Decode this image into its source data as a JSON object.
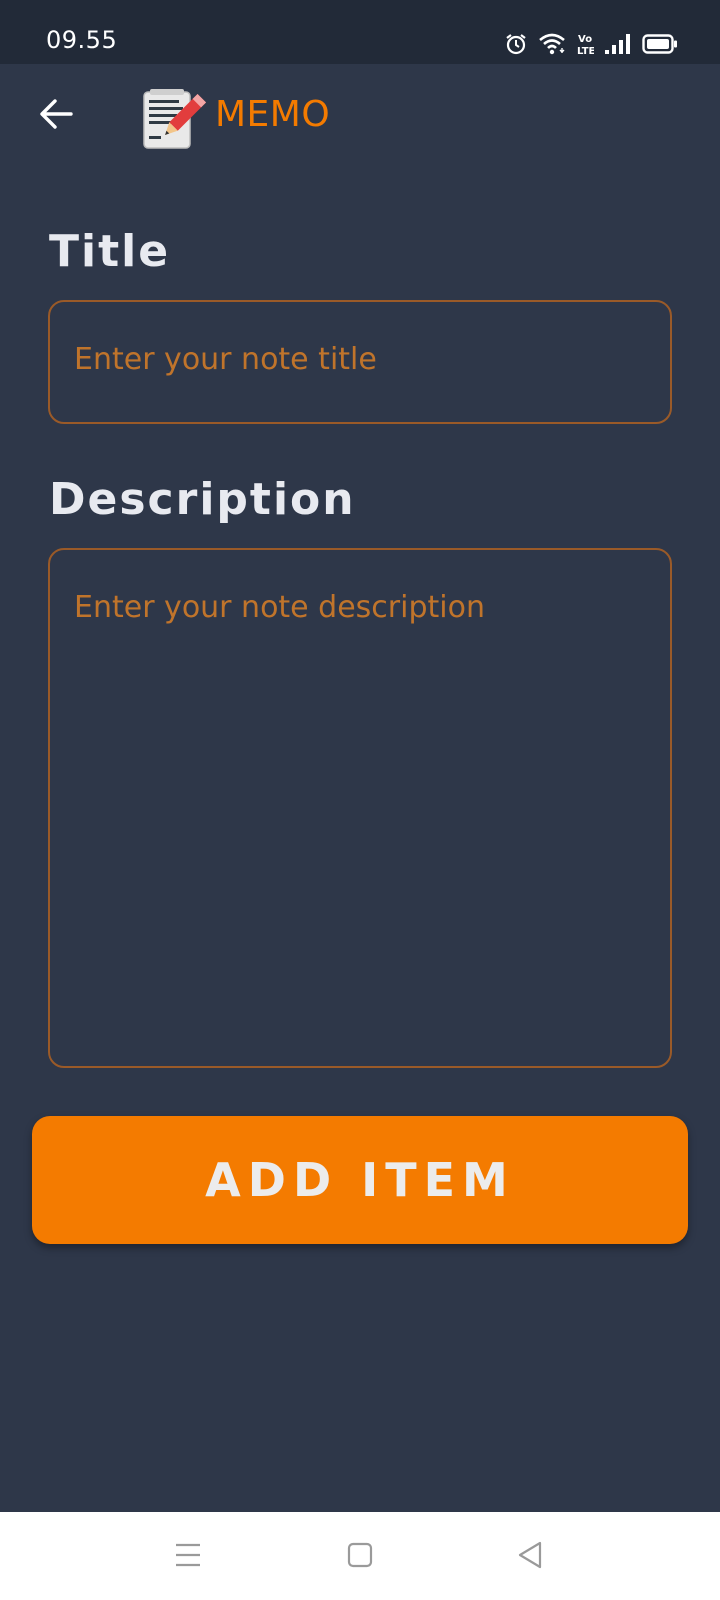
{
  "status_bar": {
    "time": "09.55",
    "icons": [
      "alarm-icon",
      "wifi-icon",
      "volte-icon",
      "signal-icon",
      "battery-icon"
    ],
    "volte_text": "Vo LTE"
  },
  "app_bar": {
    "title": "MEMO",
    "back_icon": "arrow-left-icon",
    "logo_icon": "memo-notepad-pencil-icon"
  },
  "form": {
    "title_label": "Title",
    "title_placeholder": "Enter your note title",
    "title_value": "",
    "description_label": "Description",
    "description_placeholder": "Enter your note description",
    "description_value": ""
  },
  "actions": {
    "add_item_label": "ADD ITEM"
  },
  "nav_bar": {
    "icons": [
      "menu-icon",
      "home-square-icon",
      "back-triangle-icon"
    ]
  },
  "colors": {
    "background": "#2e3749",
    "status_bar": "#222a38",
    "accent": "#f47b00",
    "input_border": "#9a5a28",
    "placeholder": "#c0742b",
    "label_text": "#e8eaf0"
  }
}
